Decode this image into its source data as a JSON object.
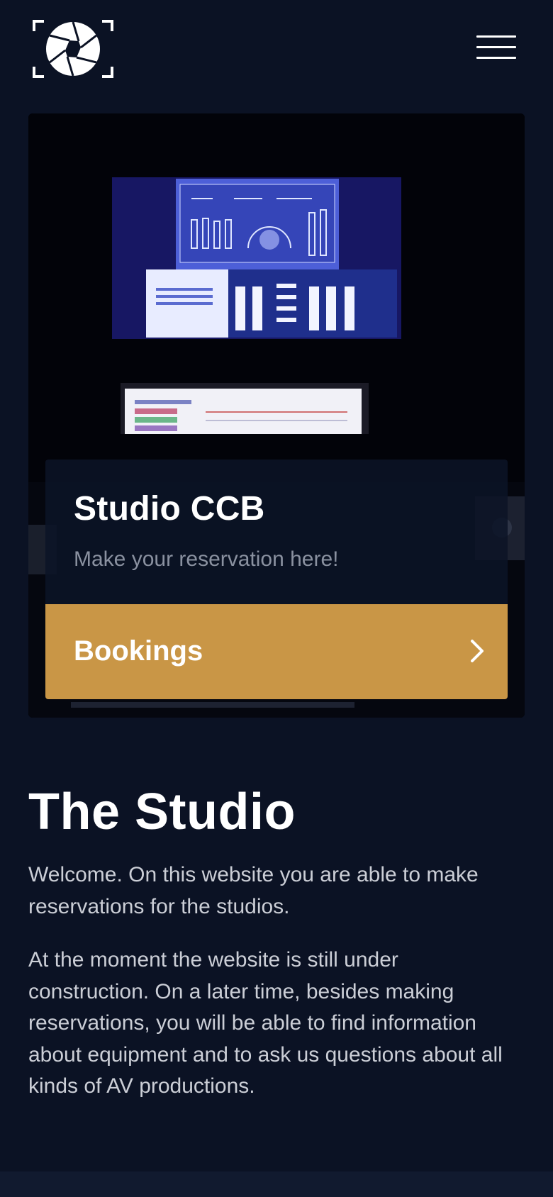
{
  "header": {
    "logo_icon": "camera-aperture-icon",
    "menu_icon": "hamburger-menu-icon"
  },
  "hero": {
    "title": "Studio CCB",
    "subtitle": "Make your reservation here!",
    "cta_label": "Bookings",
    "cta_icon": "chevron-right-icon",
    "cta_color": "#c99646"
  },
  "content": {
    "heading": "The Studio",
    "paragraph_1": "Welcome. On this website you are able to make reservations for the studios.",
    "paragraph_2": "At the moment the website is still under construction. On a later time, besides making reservations, you will be able to find information about equipment and to ask us questions about all kinds of AV productions."
  },
  "colors": {
    "background": "#0b1224",
    "accent": "#c99646",
    "muted_text": "#8a91a0",
    "body_text": "#cbced6"
  }
}
